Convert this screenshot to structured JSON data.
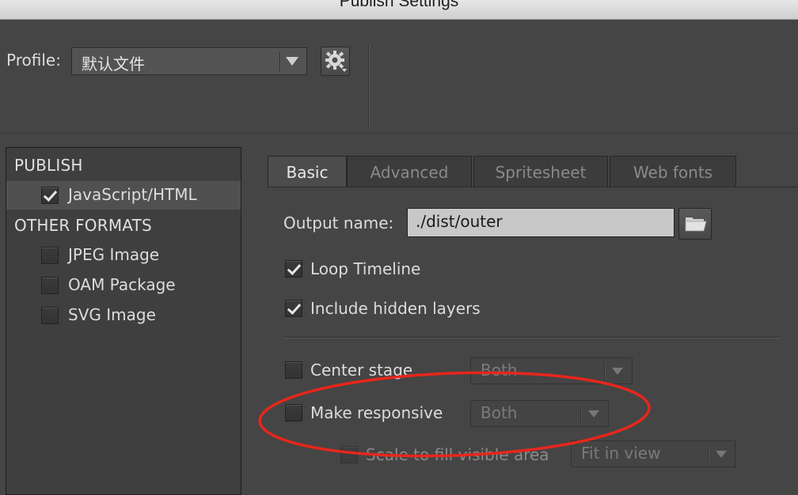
{
  "window": {
    "title": "Publish Settings"
  },
  "profile": {
    "label": "Profile:",
    "value": "默认文件"
  },
  "left_panel": {
    "publish_heading": "PUBLISH",
    "publish_items": [
      {
        "label": "JavaScript/HTML",
        "checked": true
      }
    ],
    "other_heading": "OTHER FORMATS",
    "other_items": [
      {
        "label": "JPEG Image",
        "checked": false
      },
      {
        "label": "OAM Package",
        "checked": false
      },
      {
        "label": "SVG Image",
        "checked": false
      }
    ]
  },
  "tabs": [
    {
      "label": "Basic",
      "active": true
    },
    {
      "label": "Advanced",
      "active": false
    },
    {
      "label": "Spritesheet",
      "active": false
    },
    {
      "label": "Web fonts",
      "active": false
    }
  ],
  "basic": {
    "output_label": "Output name:",
    "output_value": "./dist/outer",
    "loop_timeline": {
      "label": "Loop Timeline",
      "checked": true
    },
    "include_hidden": {
      "label": "Include hidden layers",
      "checked": true
    },
    "center_stage": {
      "label": "Center stage",
      "checked": false,
      "option": "Both"
    },
    "make_responsive": {
      "label": "Make responsive",
      "checked": false,
      "option": "Both"
    },
    "scale_fill": {
      "label": "Scale to fill visible area",
      "checked": false,
      "option": "Fit in view"
    }
  },
  "icons": {
    "gear": "gear-icon",
    "folder": "folder-icon",
    "check": "checkmark-icon",
    "dropdown": "chevron-down-icon"
  },
  "colors": {
    "background": "#454545",
    "panel": "#3f3f3f",
    "annotation": "#e8261c",
    "input_bg": "#c8c8c8"
  }
}
